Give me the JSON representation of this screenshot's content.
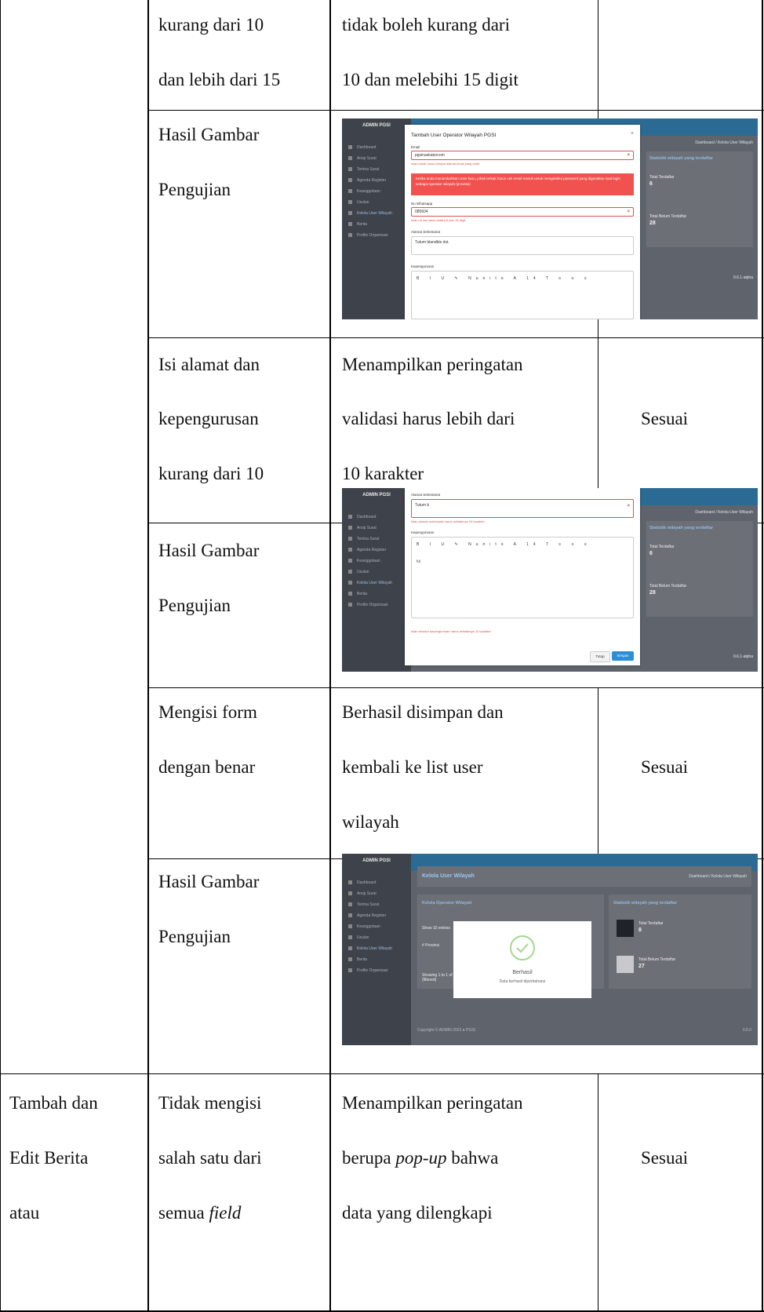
{
  "rows": {
    "r1": {
      "col2": [
        "kurang dari 10",
        "dan lebih dari 15"
      ],
      "col3": [
        "tidak boleh kurang dari",
        "10 dan melebihi 15 digit"
      ]
    },
    "r2": {
      "col2": [
        "Hasil Gambar",
        "Pengujian"
      ]
    },
    "r3": {
      "col2": [
        "Isi alamat dan",
        "kepengurusan",
        "kurang dari 10"
      ],
      "col3": [
        "Menampilkan peringatan",
        "validasi harus lebih dari",
        "10 karakter"
      ],
      "col4": "Sesuai"
    },
    "r4": {
      "col2": [
        "Hasil Gambar",
        "Pengujian"
      ]
    },
    "r5": {
      "col2": [
        "Mengisi form",
        "dengan benar"
      ],
      "col3": [
        "Berhasil disimpan dan",
        "kembali ke list user",
        "wilayah"
      ],
      "col4": "Sesuai"
    },
    "r6": {
      "col2": [
        "Hasil Gambar",
        "Pengujian"
      ]
    },
    "r7": {
      "col1": [
        "Tambah dan",
        "Edit Berita",
        "atau"
      ],
      "col2_a": "Tidak mengisi",
      "col2_b": "salah satu dari",
      "col2_c_prefix": "semua ",
      "col2_c_italic": "field",
      "col3_a": "Menampilkan peringatan",
      "col3_b_prefix": "berupa ",
      "col3_b_italic": "pop-up",
      "col3_b_suffix": " bahwa",
      "col3_c": "data yang dilengkapi",
      "col4": "Sesuai"
    }
  },
  "screenshot_common": {
    "brand": "ADMIN PGSI",
    "menu": [
      "Dashboard",
      "Arsip Surat",
      "Terima Surat",
      "Agenda Register",
      "Keanggotaan",
      "Usulan",
      "Kelola User Wilayah",
      "Berita",
      "Profile Organisasi"
    ],
    "breadcrumb": "Dashboard / Kelola User Wilayah",
    "stats_title": "Statistik wilayah yang terdaftar",
    "stat1_label": "Total Terdaftar",
    "stat2_label": "Total Belum Terdaftar",
    "version": "0.6.1-alpha"
  },
  "shot1": {
    "modal_title": "Tambah User Operator Wilayah PGSI",
    "email_label": "Email",
    "email_value": "pgsinaskatorcom",
    "email_error": "Isian email harus berupa alamat email yang valid.",
    "alert_text": "Ketika anda menambahkan User baru, pihak terkait harus cek email masuk untuk mengetahui password yang digunakan saat login sebagai operator wilayah (provinsi)",
    "wa_label": "No Whatsapp",
    "wa_value": "085604",
    "wa_error": "Isian no wa harus antara 8 dan 15 digit.",
    "address_label": "Alamat Sekretariat",
    "address_value": "Tutum blandbts dst.",
    "board_label": "Kepengurusan",
    "toolbar": "B I U ✎ Nunito A 14 T ≡ ≡ ≡",
    "stat1_value": "6",
    "stat2_value": "28"
  },
  "shot2": {
    "address_label": "Alamat Sekretariat",
    "address_value": "Tutum b",
    "address_error": "Isian alamat sekretariat harus setidaknya 10 karakter.",
    "board_label": "Kepengurusan",
    "board_value": "ful",
    "board_error": "Isian struktur kepengurusan harus setidaknya 10 karakter.",
    "close_btn": "Tutup",
    "save_btn": "Simpan",
    "stat1_value": "6",
    "stat2_value": "28"
  },
  "shot3": {
    "page_title": "Kelola User Wilayah",
    "panel_title": "Kelola Operator Wilayah",
    "show_label": "Show 10 entries",
    "row_label": "#  Provinsi",
    "showing": "Showing 1 to 1 of 1 entries (filtered)",
    "popup_title": "Berhasil",
    "popup_text": "Data berhasil diperbaharui",
    "stat1_value": "8",
    "stat2_value": "27",
    "footer": "Copyright © ADMIN 2023 ● PGSI",
    "footer_right": "0.6.0"
  }
}
